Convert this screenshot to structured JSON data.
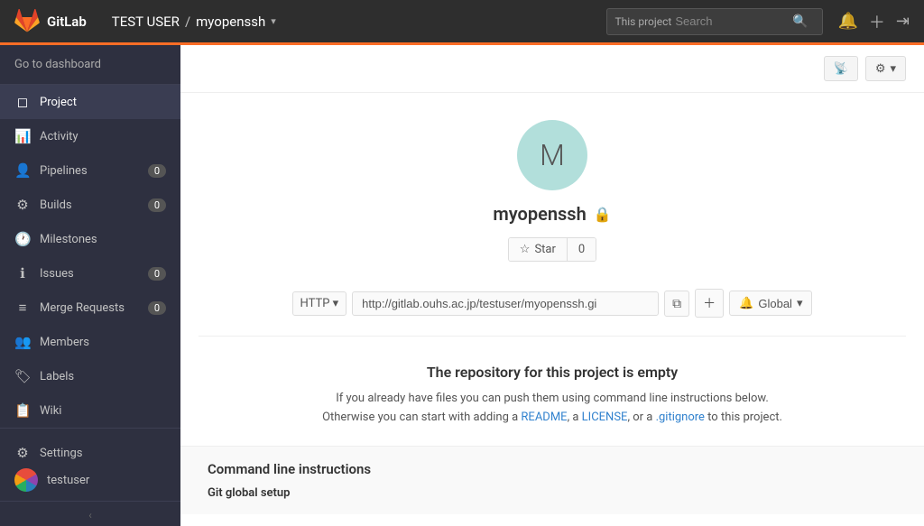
{
  "app": {
    "title": "GitLab"
  },
  "topnav": {
    "breadcrumb_user": "TEST USER",
    "breadcrumb_project": "myopenssh",
    "search_label": "This project",
    "search_placeholder": "Search"
  },
  "sidebar": {
    "dashboard_label": "Go to dashboard",
    "items": [
      {
        "id": "project",
        "icon": "📁",
        "label": "Project",
        "badge": null,
        "active": true
      },
      {
        "id": "activity",
        "icon": "🕐",
        "label": "Activity",
        "badge": null,
        "active": false
      },
      {
        "id": "pipelines",
        "icon": "👤",
        "label": "Pipelines",
        "badge": "0",
        "active": false
      },
      {
        "id": "builds",
        "icon": "⚙",
        "label": "Builds",
        "badge": "0",
        "active": false
      },
      {
        "id": "milestones",
        "icon": "🕐",
        "label": "Milestones",
        "badge": null,
        "active": false
      },
      {
        "id": "issues",
        "icon": "ℹ",
        "label": "Issues",
        "badge": "0",
        "active": false
      },
      {
        "id": "merge-requests",
        "icon": "≡",
        "label": "Merge Requests",
        "badge": "0",
        "active": false
      },
      {
        "id": "members",
        "icon": "👥",
        "label": "Members",
        "badge": null,
        "active": false
      },
      {
        "id": "labels",
        "icon": "🏷",
        "label": "Labels",
        "badge": null,
        "active": false
      },
      {
        "id": "wiki",
        "icon": "📋",
        "label": "Wiki",
        "badge": null,
        "active": false
      }
    ],
    "settings_label": "Settings",
    "user": "testuser",
    "collapse_label": "‹"
  },
  "main": {
    "project_name": "myopenssh",
    "project_initial": "M",
    "star_label": "Star",
    "star_count": "0",
    "clone_protocol": "HTTP ▾",
    "clone_url": "http://gitlab.ouhs.ac.jp/testuser/myopenssh.gi",
    "notification_label": "🔔 Global ▾",
    "empty_title": "The repository for this project is empty",
    "empty_desc1": "If you already have files you can push them using command line instructions below.",
    "empty_desc2_pre": "Otherwise you can start with adding a ",
    "empty_desc2_readme": "README",
    "empty_desc2_mid1": ", a ",
    "empty_desc2_license": "LICENSE",
    "empty_desc2_mid2": ", or a ",
    "empty_desc2_gitignore": ".gitignore",
    "empty_desc2_post": " to this project.",
    "cli_title": "Command line instructions",
    "cli_subtitle": "Git global setup"
  },
  "colors": {
    "orange": "#fc6d26",
    "sidebar_bg": "#2e3040",
    "link": "#3182ce"
  }
}
